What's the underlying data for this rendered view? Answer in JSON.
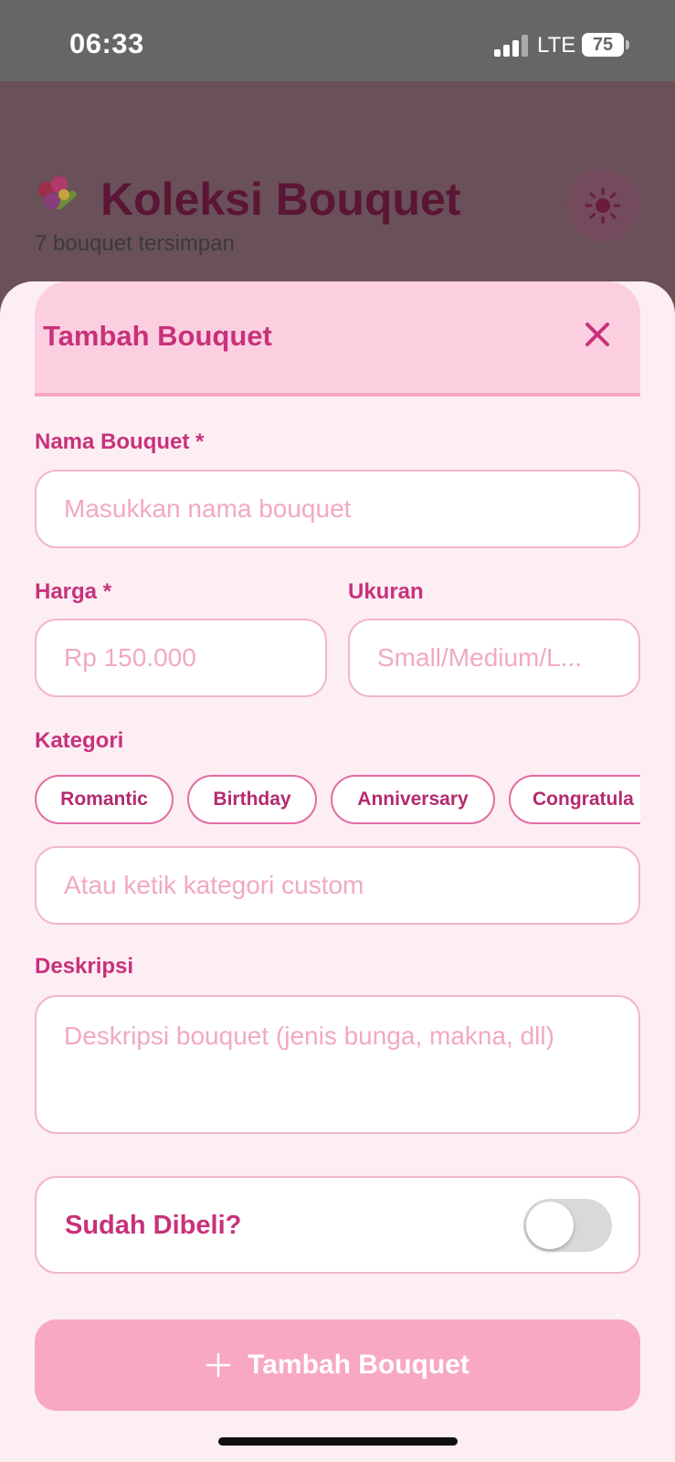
{
  "status_bar": {
    "time": "06:33",
    "network": "LTE",
    "battery": "75"
  },
  "background": {
    "title": "Koleksi Bouquet",
    "subtitle": "7 bouquet tersimpan",
    "title_icon": "bouquet-icon",
    "theme_icon": "sun-icon"
  },
  "sheet": {
    "title": "Tambah Bouquet",
    "close_icon": "close-icon",
    "name_label": "Nama Bouquet *",
    "name_placeholder": "Masukkan nama bouquet",
    "price_label": "Harga *",
    "price_placeholder": "Rp 150.000",
    "size_label": "Ukuran",
    "size_placeholder": "Small/Medium/L...",
    "category_label": "Kategori",
    "categories": [
      "Romantic",
      "Birthday",
      "Anniversary",
      "Congratula"
    ],
    "custom_category_placeholder": "Atau ketik kategori custom",
    "description_label": "Deskripsi",
    "description_placeholder": "Deskripsi bouquet (jenis bunga, makna, dll)",
    "purchased_label": "Sudah Dibeli?",
    "purchased": false,
    "submit_label": "Tambah Bouquet",
    "submit_icon": "plus-icon"
  },
  "colors": {
    "accent": "#c8317b",
    "sheet_bg": "#fdeef3",
    "header_bg": "#fccfe0",
    "button_bg": "#f8a7c5",
    "placeholder": "#f2a8c6"
  }
}
